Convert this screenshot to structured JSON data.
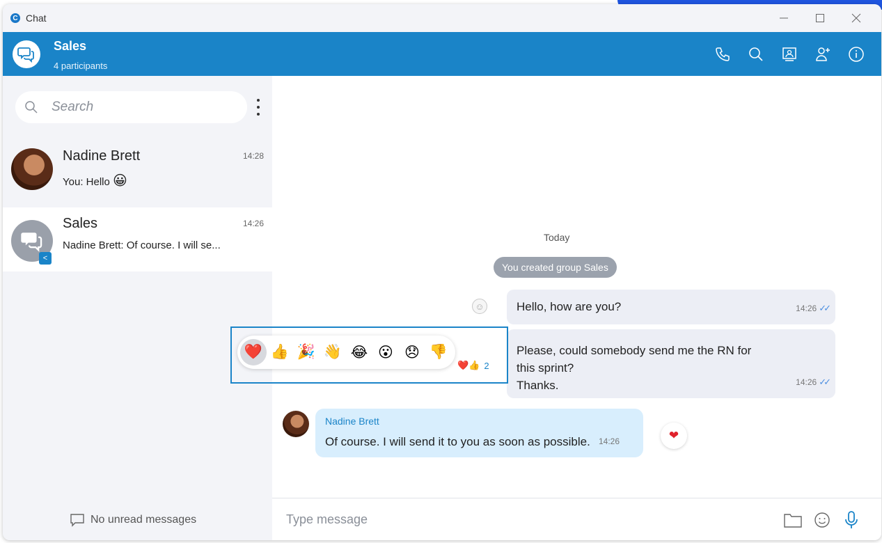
{
  "window": {
    "app_title": "Chat",
    "app_logo_letter": "C"
  },
  "header": {
    "title": "Sales",
    "subtitle": "4 participants"
  },
  "sidebar": {
    "search_placeholder": "Search",
    "conversations": [
      {
        "name": "Nadine Brett",
        "time": "14:28",
        "preview": "You: Hello",
        "preview_emoji": "😀"
      },
      {
        "name": "Sales",
        "time": "14:26",
        "preview": "Nadine Brett: Of course. I will se..."
      }
    ],
    "no_unread": "No unread messages"
  },
  "chat": {
    "date_label": "Today",
    "system_message": "You created group Sales",
    "messages": [
      {
        "text": "Hello, how are you?",
        "time": "14:26"
      },
      {
        "text_line1": "Please, could somebody send me the RN for",
        "text_line2": "this sprint?",
        "text_line3": "Thanks.",
        "time": "14:26"
      },
      {
        "sender": "Nadine Brett",
        "text": "Of course. I will send it to you as soon as possible.",
        "time": "14:26"
      }
    ],
    "reaction_summary": {
      "emojis": "❤️👍",
      "count": "2"
    },
    "heart_reaction": "❤"
  },
  "emoji_picker": [
    "❤️",
    "👍",
    "🎉",
    "👋",
    "😂",
    "😮",
    "😞",
    "👎"
  ],
  "input": {
    "placeholder": "Type message"
  },
  "colors": {
    "brand": "#1a84c8",
    "accent_corner": "#1f55e0",
    "incoming_bubble": "#d8eefd",
    "outgoing_bubble": "#eceef5",
    "ticks": "#4d8fe0"
  }
}
